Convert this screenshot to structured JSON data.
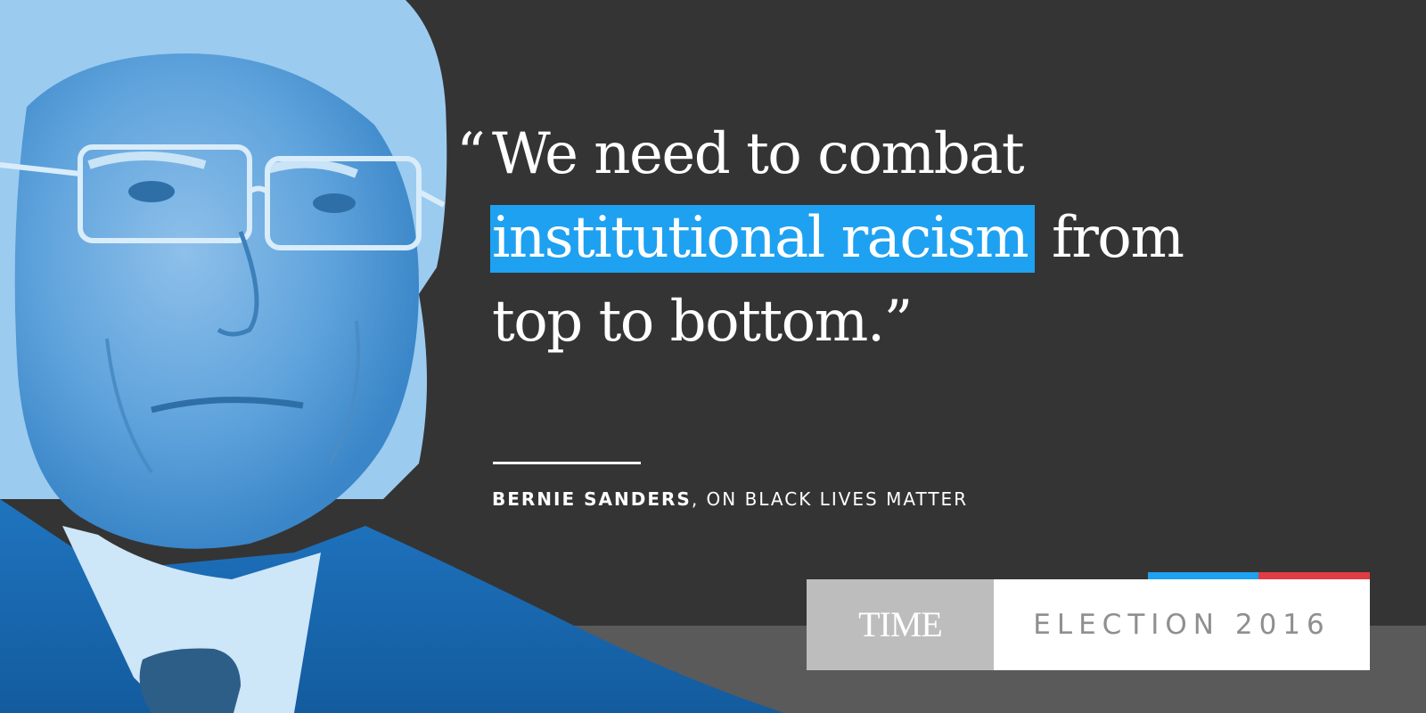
{
  "quote": {
    "open_mark": "“",
    "line1": "We need to combat",
    "highlight": "institutional racism",
    "line2_rest": "from",
    "line3": "top to bottom.”"
  },
  "attribution": {
    "speaker": "BERNIE SANDERS",
    "topic": ", ON BLACK LIVES MATTER"
  },
  "brand": {
    "logo": "TIME",
    "label": "ELECTION 2016"
  },
  "photo": {
    "subject": "portrait-photo",
    "tint": "#2a86cf"
  },
  "colors": {
    "background": "#343434",
    "highlight": "#1ea1f1",
    "accent_red": "#e03c44",
    "band": "#5a5a5a"
  }
}
